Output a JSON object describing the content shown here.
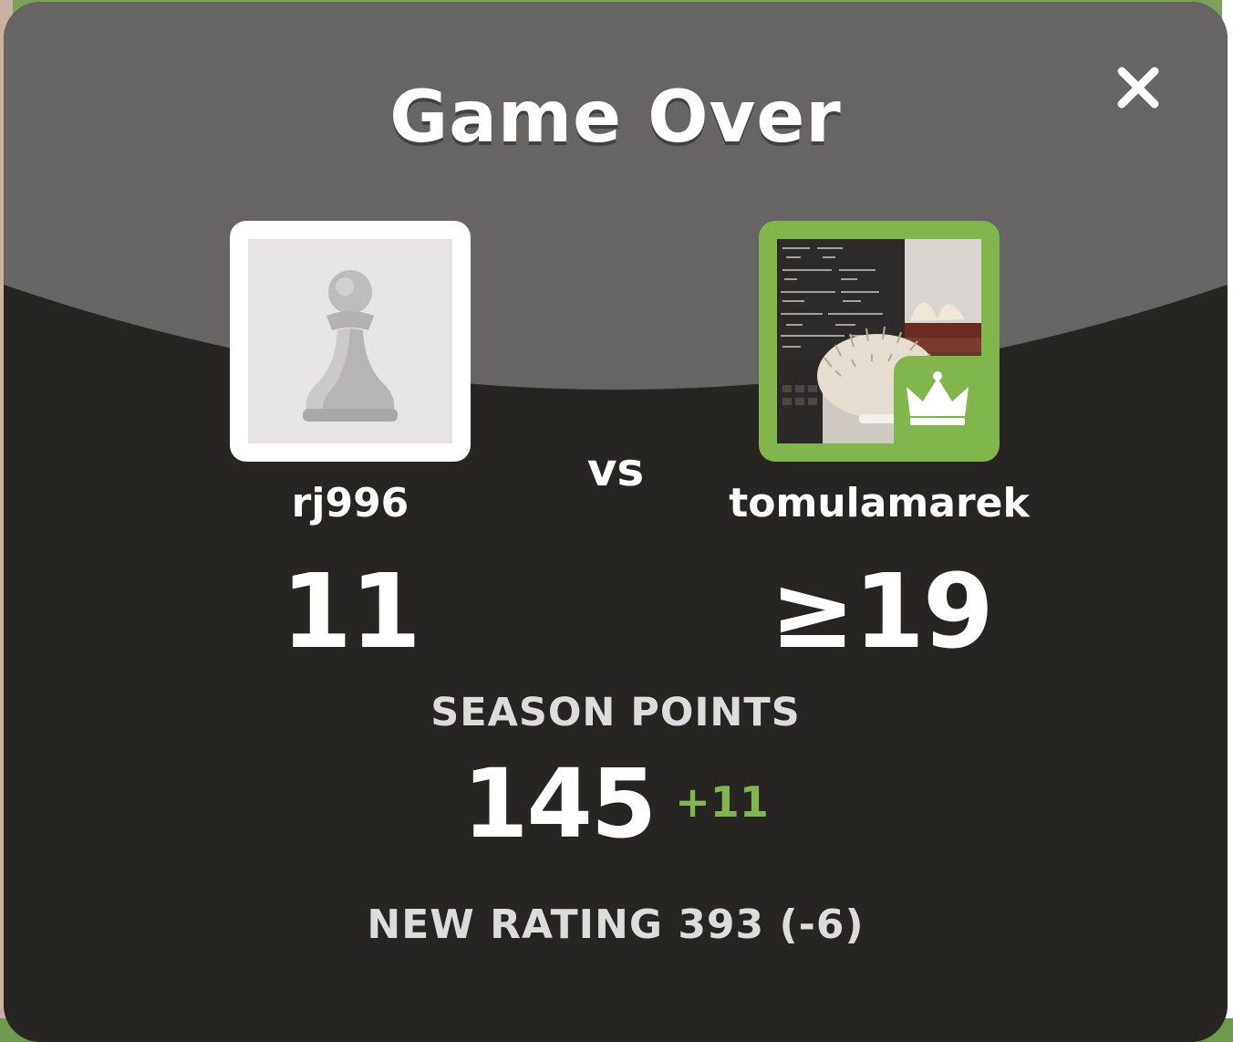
{
  "dialog": {
    "title": "Game Over",
    "close_icon": "close-icon"
  },
  "players": {
    "left": {
      "username": "rj996",
      "score": "11",
      "avatar_icon": "pawn-icon"
    },
    "vs_label": "vs",
    "right": {
      "username": "tomulamarek",
      "score": "≥19",
      "avatar_description": "hedgehog with books and chalkboard",
      "badge_icon": "crown-icon"
    }
  },
  "season": {
    "label": "SEASON POINTS",
    "value": "145",
    "delta": "+11"
  },
  "rating": {
    "text": "NEW RATING 393 (-6)"
  },
  "colors": {
    "accent_green": "#81b64c",
    "panel_dark": "#262522",
    "header_gray": "#666564"
  }
}
